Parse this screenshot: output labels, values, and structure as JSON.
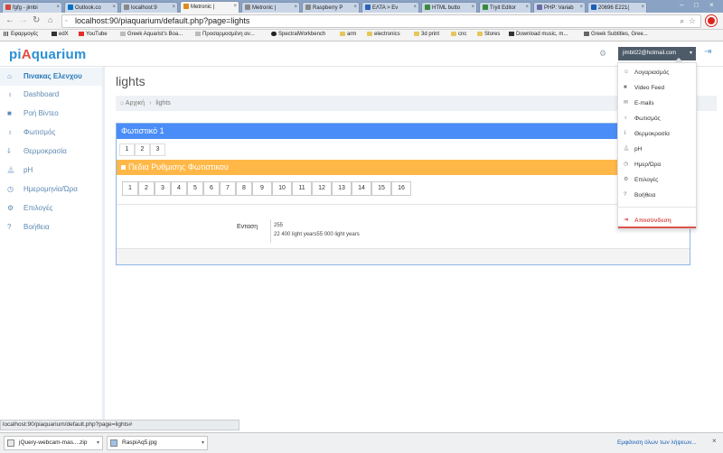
{
  "browser": {
    "tabs": [
      {
        "label": "fgfg - jimbi",
        "fav": "#d44638"
      },
      {
        "label": "Outlook.co",
        "fav": "#0072c6"
      },
      {
        "label": "localhost:9",
        "fav": "#888888"
      },
      {
        "label": "Metronic |",
        "fav": "#e08a1e"
      },
      {
        "label": "Metronic |",
        "fav": "#888888"
      },
      {
        "label": "Raspberry P",
        "fav": "#888888"
      },
      {
        "label": "ΕΛΤΑ > Εν",
        "fav": "#2a62b8"
      },
      {
        "label": "HTML butto",
        "fav": "#3a8a3a"
      },
      {
        "label": "Tryit Editor",
        "fav": "#3a8a3a"
      },
      {
        "label": "PHP: Variab",
        "fav": "#6a6aa8"
      },
      {
        "label": "20696 E221(",
        "fav": "#1a5fb4"
      }
    ],
    "url_host": "localhost",
    "url_path": ":90/piaquarium/default.php?page=lights",
    "bookmarks": [
      {
        "label": "Εφαρμογές",
        "icon": "apps-icon"
      },
      {
        "label": "edX",
        "icon": "edx-icon"
      },
      {
        "label": "YouTube",
        "icon": "youtube-icon"
      },
      {
        "label": "Greek Aquarist's Boa...",
        "icon": "page-icon"
      },
      {
        "label": "Προσαρμοσμένη αν...",
        "icon": "page-icon"
      },
      {
        "label": "SpectralWorkbench",
        "icon": "page-icon"
      },
      {
        "label": "arm",
        "icon": "folder-icon"
      },
      {
        "label": "electronics",
        "icon": "folder-icon"
      },
      {
        "label": "3d print",
        "icon": "folder-icon"
      },
      {
        "label": "cnc",
        "icon": "folder-icon"
      },
      {
        "label": "Stores",
        "icon": "folder-icon"
      },
      {
        "label": "Download music, m...",
        "icon": "page-icon"
      },
      {
        "label": "Greek Subtitles, Gree...",
        "icon": "page-icon"
      }
    ],
    "status_url": "localhost:90/piaquarium/default.php?page=lights#",
    "downloads": [
      {
        "label": "jQuery-webcam-mas....zip"
      },
      {
        "label": "RaspiAq5.jpg"
      }
    ],
    "show_all_downloads": "Εμφάνιση όλων των λήψεων..."
  },
  "app": {
    "logo_prefix": "pi",
    "logo_accent": "A",
    "logo_suffix": "quarium",
    "user_email": "jimbit22@hotmail.com",
    "colors": {
      "blue": "#4b8df8",
      "yellow": "#ffb848",
      "logout_red": "#d9534f"
    }
  },
  "sidebar": {
    "items": [
      {
        "label": "Πινακας Ελενχου",
        "icon": "home-icon"
      },
      {
        "label": "Dashboard",
        "icon": "bulb-icon"
      },
      {
        "label": "Ροή Βίντεο",
        "icon": "video-icon"
      },
      {
        "label": "Φωτισμός",
        "icon": "bulb-icon"
      },
      {
        "label": "Θερμοκρασία",
        "icon": "thermometer-icon"
      },
      {
        "label": "pH",
        "icon": "flask-icon"
      },
      {
        "label": "Ημερομηνία/Ώρα",
        "icon": "clock-icon"
      },
      {
        "label": "Επιλογές",
        "icon": "gears-icon"
      },
      {
        "label": "Βοήθεια",
        "icon": "question-icon"
      }
    ]
  },
  "main": {
    "page_title": "lights",
    "breadcrumb": {
      "home": "Αρχική",
      "current": "lights"
    },
    "portlet1": {
      "title": "Φωτιστικό 1",
      "tabs": [
        "1",
        "2",
        "3"
      ]
    },
    "portlet2": {
      "title": "Πεδια Ρυθμισης Φωτιστικου",
      "buttons": [
        "1",
        "2",
        "3",
        "4",
        "5",
        "6",
        "7",
        "8",
        "9",
        "10",
        "11",
        "12",
        "13",
        "14",
        "15",
        "16"
      ]
    },
    "detail": {
      "label": "Ενταση",
      "value1": "255",
      "value2": "22 400 light years55 000 light years"
    }
  },
  "dropdown": {
    "items": [
      {
        "label": "Λογαριασμός",
        "icon": "user-icon"
      },
      {
        "label": "Video Feed",
        "icon": "video-icon"
      },
      {
        "label": "E-mails",
        "icon": "envelope-icon"
      },
      {
        "label": "Φωτισμός",
        "icon": "bulb-icon"
      },
      {
        "label": "Θερμοκρασία",
        "icon": "thermometer-icon"
      },
      {
        "label": "pH",
        "icon": "flask-icon"
      },
      {
        "label": "Ημερ/Ώρα",
        "icon": "clock-icon"
      },
      {
        "label": "Επιλογές",
        "icon": "gears-icon"
      },
      {
        "label": "Βοήθεια",
        "icon": "question-icon"
      }
    ],
    "logout": "Αποσύνδεση"
  }
}
